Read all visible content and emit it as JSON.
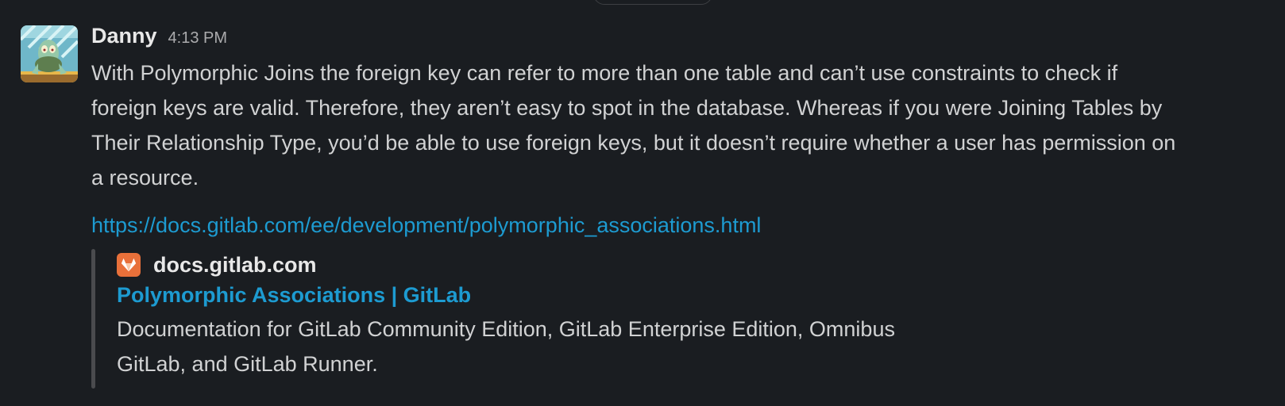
{
  "message": {
    "author": "Danny",
    "timestamp": "4:13 PM",
    "avatar_icon": "cartoon-avatar-icon",
    "body_lines": [
      "With Polymorphic Joins the foreign key can refer to more than one table and can’t use constraints to check if",
      "foreign keys are valid. Therefore, they aren’t easy to spot in the database. Whereas if you were Joining Tables by",
      "Their Relationship Type, you’d be able to use foreign keys, but it doesn’t require whether a user has permission on",
      "a resource."
    ],
    "link": "https://docs.gitlab.com/ee/development/polymorphic_associations.html"
  },
  "unfurl": {
    "site_icon": "gitlab-icon",
    "site_name": "docs.gitlab.com",
    "title": "Polymorphic Associations | GitLab",
    "description_lines": [
      "Documentation for GitLab Community Edition, GitLab Enterprise Edition, Omnibus",
      "GitLab, and GitLab Runner."
    ]
  },
  "colors": {
    "background": "#1a1d21",
    "text": "#d1d2d3",
    "link": "#1d9bd1",
    "gitlab_orange": "#e8703a",
    "quote_bar": "#4a4b4e"
  }
}
